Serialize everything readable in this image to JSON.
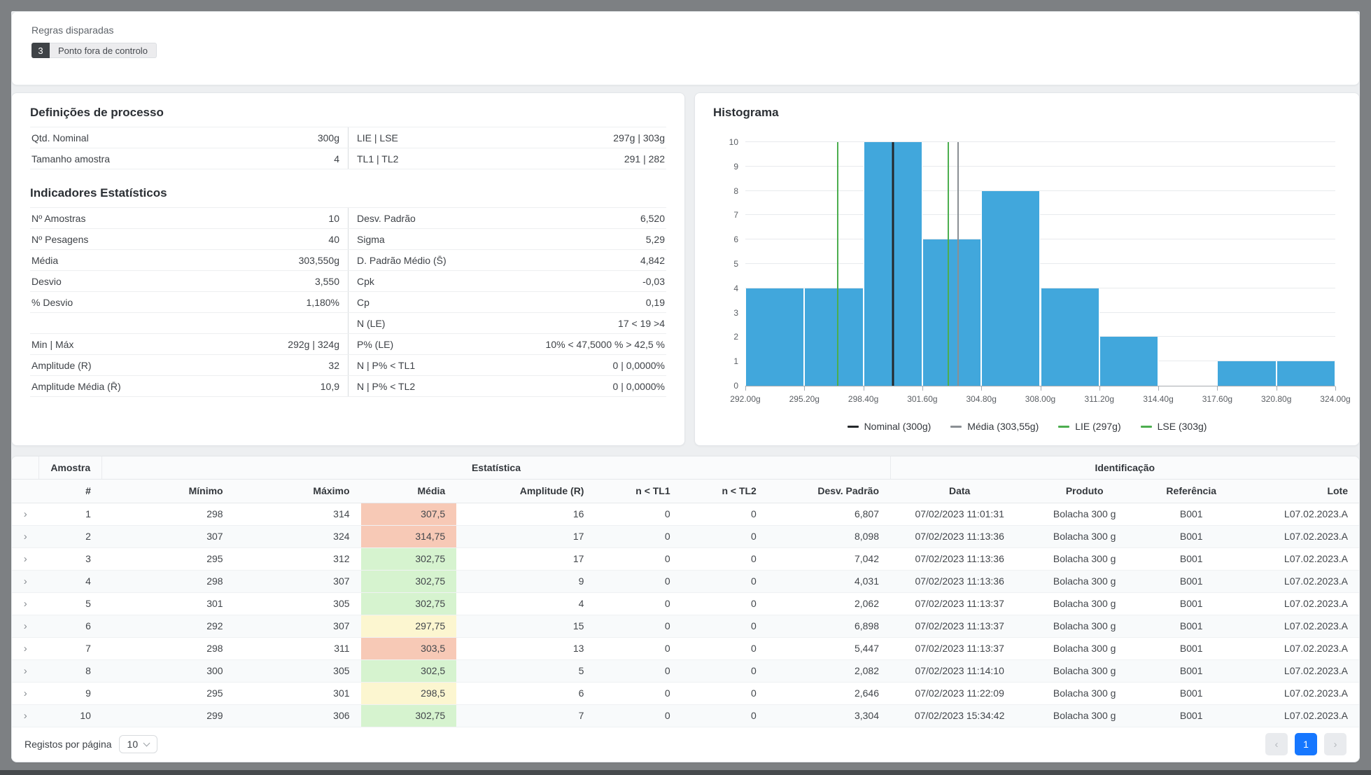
{
  "rules": {
    "title": "Regras disparadas",
    "count": "3",
    "rule_label": "Ponto fora de controlo"
  },
  "process": {
    "title": "Definições de processo",
    "rows": [
      {
        "l1": "Qtd. Nominal",
        "v1": "300g",
        "l2": "LIE | LSE",
        "v2": "297g | 303g"
      },
      {
        "l1": "Tamanho amostra",
        "v1": "4",
        "l2": "TL1 | TL2",
        "v2": "291 | 282"
      }
    ]
  },
  "stats": {
    "title": "Indicadores Estatísticos",
    "rows": [
      {
        "l1": "Nº Amostras",
        "v1": "10",
        "l2": "Desv. Padrão",
        "v2": "6,520"
      },
      {
        "l1": "Nº Pesagens",
        "v1": "40",
        "l2": "Sigma",
        "v2": "5,29"
      },
      {
        "l1": "Média",
        "v1": "303,550g",
        "l2": "D. Padrão Médio (S̄)",
        "v2": "4,842"
      },
      {
        "l1": "Desvio",
        "v1": "3,550",
        "l2": "Cpk",
        "v2": "-0,03"
      },
      {
        "l1": "% Desvio",
        "v1": "1,180%",
        "l2": "Cp",
        "v2": "0,19"
      },
      {
        "l1": "",
        "v1": "",
        "l2": "N (LE)",
        "v2": "17 < 19 >4"
      },
      {
        "l1": "Min | Máx",
        "v1": "292g | 324g",
        "l2": "P% (LE)",
        "v2": "10% < 47,5000 % > 42,5 %"
      },
      {
        "l1": "Amplitude (R)",
        "v1": "32",
        "l2": "N | P% < TL1",
        "v2": "0 | 0,0000%"
      },
      {
        "l1": "Amplitude Média (R̄)",
        "v1": "10,9",
        "l2": "N | P% < TL2",
        "v2": "0 | 0,0000%"
      }
    ]
  },
  "histogram": {
    "title": "Histograma"
  },
  "chart_data": {
    "type": "bar",
    "title": "Histograma",
    "x_unit": "g",
    "bin_edges": [
      292.0,
      295.2,
      298.4,
      301.6,
      304.8,
      308.0,
      311.2,
      314.4,
      317.6,
      320.8,
      324.0
    ],
    "bin_labels": [
      "292.00g",
      "295.20g",
      "298.40g",
      "301.60g",
      "304.80g",
      "308.00g",
      "311.20g",
      "314.40g",
      "317.60g",
      "320.80g",
      "324.00g"
    ],
    "counts": [
      4,
      4,
      10,
      6,
      8,
      4,
      2,
      0,
      1,
      1
    ],
    "ylim": [
      0,
      10
    ],
    "y_ticks": [
      0,
      1,
      2,
      3,
      4,
      5,
      6,
      7,
      8,
      9,
      10
    ],
    "bar_color": "#41a7dc",
    "grid": true,
    "legend_position": "bottom",
    "reference_lines": [
      {
        "label": "Nominal (300g)",
        "value": 300,
        "color": "#24272a",
        "width": 3
      },
      {
        "label": "Média (303,55g)",
        "value": 303.55,
        "color": "#8a8f94",
        "width": 2
      },
      {
        "label": "LIE (297g)",
        "value": 297,
        "color": "#4cae4f",
        "width": 2
      },
      {
        "label": "LSE (303g)",
        "value": 303,
        "color": "#4cae4f",
        "width": 2
      }
    ]
  },
  "table": {
    "groups": [
      {
        "label": "",
        "span": 1
      },
      {
        "label": "Amostra",
        "span": 1
      },
      {
        "label": "Estatística",
        "span": 7
      },
      {
        "label": "Identificação",
        "span": 4
      }
    ],
    "columns": [
      "#",
      "Mínimo",
      "Máximo",
      "Média",
      "Amplitude (R)",
      "n < TL1",
      "n < TL2",
      "Desv. Padrão",
      "Data",
      "Produto",
      "Referência",
      "Lote"
    ],
    "rows": [
      {
        "num": "1",
        "min": "298",
        "max": "314",
        "media": "307,5",
        "media_status": "red",
        "amplitude": "16",
        "ntl1": "0",
        "ntl2": "0",
        "desv": "6,807",
        "data": "07/02/2023 11:01:31",
        "produto": "Bolacha 300 g",
        "ref": "B001",
        "lote": "L07.02.2023.A"
      },
      {
        "num": "2",
        "min": "307",
        "max": "324",
        "media": "314,75",
        "media_status": "red",
        "amplitude": "17",
        "ntl1": "0",
        "ntl2": "0",
        "desv": "8,098",
        "data": "07/02/2023 11:13:36",
        "produto": "Bolacha 300 g",
        "ref": "B001",
        "lote": "L07.02.2023.A"
      },
      {
        "num": "3",
        "min": "295",
        "max": "312",
        "media": "302,75",
        "media_status": "green",
        "amplitude": "17",
        "ntl1": "0",
        "ntl2": "0",
        "desv": "7,042",
        "data": "07/02/2023 11:13:36",
        "produto": "Bolacha 300 g",
        "ref": "B001",
        "lote": "L07.02.2023.A"
      },
      {
        "num": "4",
        "min": "298",
        "max": "307",
        "media": "302,75",
        "media_status": "green",
        "amplitude": "9",
        "ntl1": "0",
        "ntl2": "0",
        "desv": "4,031",
        "data": "07/02/2023 11:13:36",
        "produto": "Bolacha 300 g",
        "ref": "B001",
        "lote": "L07.02.2023.A"
      },
      {
        "num": "5",
        "min": "301",
        "max": "305",
        "media": "302,75",
        "media_status": "green",
        "amplitude": "4",
        "ntl1": "0",
        "ntl2": "0",
        "desv": "2,062",
        "data": "07/02/2023 11:13:37",
        "produto": "Bolacha 300 g",
        "ref": "B001",
        "lote": "L07.02.2023.A"
      },
      {
        "num": "6",
        "min": "292",
        "max": "307",
        "media": "297,75",
        "media_status": "yellow",
        "amplitude": "15",
        "ntl1": "0",
        "ntl2": "0",
        "desv": "6,898",
        "data": "07/02/2023 11:13:37",
        "produto": "Bolacha 300 g",
        "ref": "B001",
        "lote": "L07.02.2023.A"
      },
      {
        "num": "7",
        "min": "298",
        "max": "311",
        "media": "303,5",
        "media_status": "red",
        "amplitude": "13",
        "ntl1": "0",
        "ntl2": "0",
        "desv": "5,447",
        "data": "07/02/2023 11:13:37",
        "produto": "Bolacha 300 g",
        "ref": "B001",
        "lote": "L07.02.2023.A"
      },
      {
        "num": "8",
        "min": "300",
        "max": "305",
        "media": "302,5",
        "media_status": "green",
        "amplitude": "5",
        "ntl1": "0",
        "ntl2": "0",
        "desv": "2,082",
        "data": "07/02/2023 11:14:10",
        "produto": "Bolacha 300 g",
        "ref": "B001",
        "lote": "L07.02.2023.A"
      },
      {
        "num": "9",
        "min": "295",
        "max": "301",
        "media": "298,5",
        "media_status": "yellow",
        "amplitude": "6",
        "ntl1": "0",
        "ntl2": "0",
        "desv": "2,646",
        "data": "07/02/2023 11:22:09",
        "produto": "Bolacha 300 g",
        "ref": "B001",
        "lote": "L07.02.2023.A"
      },
      {
        "num": "10",
        "min": "299",
        "max": "306",
        "media": "302,75",
        "media_status": "green",
        "amplitude": "7",
        "ntl1": "0",
        "ntl2": "0",
        "desv": "3,304",
        "data": "07/02/2023 15:34:42",
        "produto": "Bolacha 300 g",
        "ref": "B001",
        "lote": "L07.02.2023.A"
      }
    ],
    "footer": {
      "per_page_label": "Registos por página",
      "per_page_value": "10",
      "page": "1"
    }
  },
  "icons": {
    "expander_char": "›",
    "prev_char": "‹",
    "next_char": "›",
    "select_caret": "chevron-down"
  },
  "colors": {
    "accent": "#1677ff",
    "badge_bg": "#3f4347",
    "bar": "#41a7dc",
    "nominal_line": "#24272a",
    "media_line": "#8a8f94",
    "spec_line": "#4cae4f",
    "status": {
      "red": "#f7c9b6",
      "yellow": "#fcf6d0",
      "green": "#d6f3cf"
    }
  }
}
